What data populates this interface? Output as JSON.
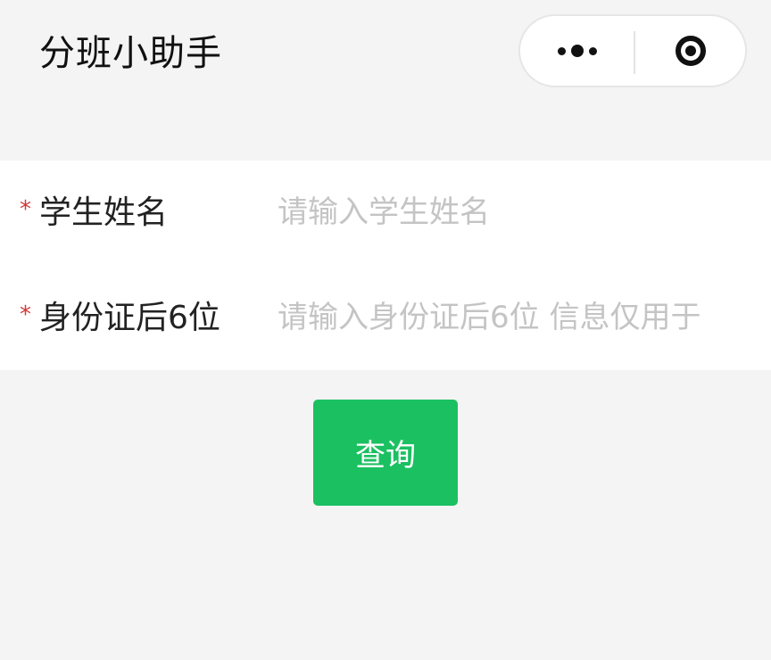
{
  "nav": {
    "title": "分班小助手",
    "more_icon": "more-dots-icon",
    "close_icon": "target-circle-icon"
  },
  "form": {
    "required_mark": "*",
    "fields": [
      {
        "label": "学生姓名",
        "value": "",
        "placeholder": "请输入学生姓名"
      },
      {
        "label": "身份证后6位",
        "value": "",
        "placeholder": "请输入身份证后6位 信息仅用于"
      }
    ]
  },
  "actions": {
    "query_label": "查询"
  },
  "colors": {
    "background": "#f4f4f4",
    "panel": "#ffffff",
    "primary_green": "#1bc061",
    "required_red": "#d03838",
    "placeholder_gray": "#c4c4c4"
  }
}
